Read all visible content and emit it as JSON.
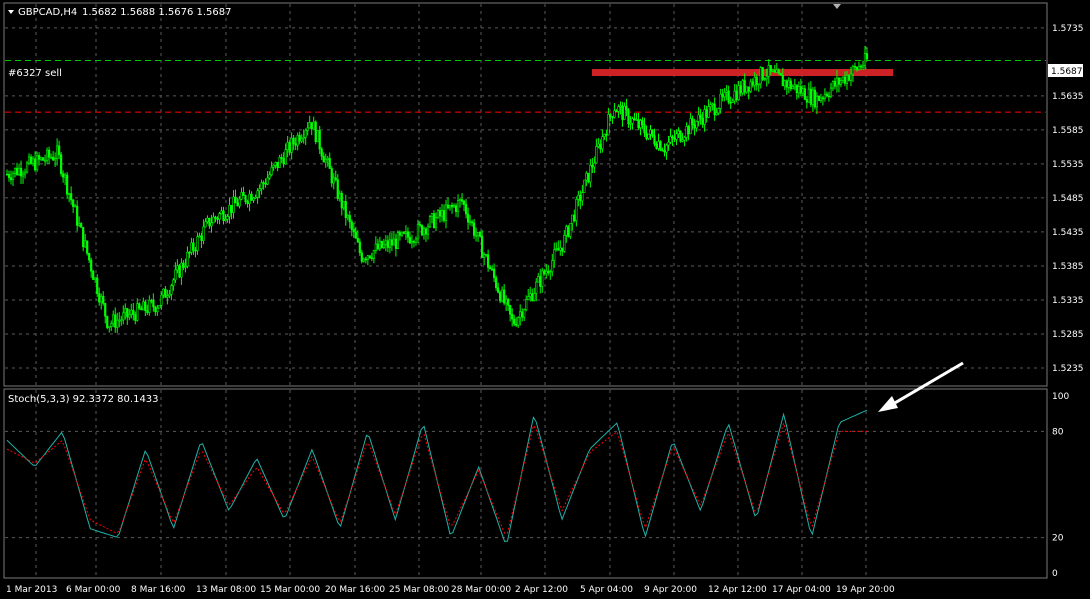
{
  "window": {
    "symbol_header": "GBPCAD,H4",
    "ohlc": "1.5682 1.5688 1.5676 1.5687"
  },
  "colors": {
    "background": "#000000",
    "grid": "#5a5a5a",
    "candle_up": "#00ff00",
    "candle_down": "#00ff00",
    "order_line": "#00c800",
    "stop_line": "#ff0000",
    "highlight_box": "#e2262a",
    "stoch_main": "#20b2aa",
    "stoch_signal": "#ff0000",
    "arrow": "#ffffff"
  },
  "icons": {
    "menu": "triangle-down-icon",
    "marker": "triangle-down-icon",
    "annotation": "arrow-icon"
  },
  "price_panel": {
    "order_label": "#6327 sell",
    "current_price": "1.5687",
    "price_ticks": [
      "1.5735",
      "1.5635",
      "1.5585",
      "1.5535",
      "1.5485",
      "1.5435",
      "1.5385",
      "1.5335",
      "1.5285",
      "1.5235"
    ]
  },
  "stoch_panel": {
    "label": "Stoch(5,3,3) 92.3372 80.1433",
    "ticks": [
      "100",
      "80",
      "20",
      "0"
    ]
  },
  "time_axis": {
    "labels": [
      "1 Mar 2013",
      "6 Mar 00:00",
      "8 Mar 16:00",
      "13 Mar 08:00",
      "15 Mar 00:00",
      "20 Mar 16:00",
      "25 Mar 08:00",
      "28 Mar 00:00",
      "2 Apr 12:00",
      "5 Apr 04:00",
      "9 Apr 20:00",
      "12 Apr 12:00",
      "17 Apr 04:00",
      "19 Apr 20:00"
    ]
  },
  "chart_data": [
    {
      "type": "candlestick",
      "title": "GBPCAD,H4",
      "ylim": [
        1.521,
        1.577
      ],
      "order_price": 1.5687,
      "stop_price": 1.5611,
      "x": [
        "1 Mar 2013",
        "6 Mar 00:00",
        "8 Mar 16:00",
        "13 Mar 08:00",
        "15 Mar 00:00",
        "20 Mar 16:00",
        "25 Mar 08:00",
        "28 Mar 00:00",
        "2 Apr 12:00",
        "5 Apr 04:00",
        "9 Apr 20:00",
        "12 Apr 12:00",
        "17 Apr 04:00",
        "19 Apr 20:00"
      ],
      "close": [
        1.552,
        1.555,
        1.53,
        1.533,
        1.545,
        1.55,
        1.56,
        1.54,
        1.543,
        1.548,
        1.53,
        1.542,
        1.562,
        1.556,
        1.562,
        1.567,
        1.563,
        1.5687
      ]
    },
    {
      "type": "line",
      "title": "Stoch(5,3,3)",
      "ylim": [
        0,
        100
      ],
      "series": [
        {
          "values": [
            75,
            60,
            80,
            25,
            20,
            70,
            25,
            75,
            35,
            65,
            30,
            70,
            25,
            80,
            30,
            85,
            20,
            60,
            15,
            90,
            30,
            70,
            85,
            20,
            75,
            35,
            85,
            30,
            90,
            20,
            85,
            92
          ]
        },
        {
          "values": [
            70,
            62,
            75,
            30,
            22,
            65,
            28,
            70,
            38,
            60,
            33,
            66,
            28,
            75,
            33,
            80,
            25,
            58,
            20,
            85,
            35,
            68,
            80,
            25,
            72,
            38,
            80,
            33,
            85,
            25,
            80,
            80
          ]
        }
      ]
    }
  ]
}
